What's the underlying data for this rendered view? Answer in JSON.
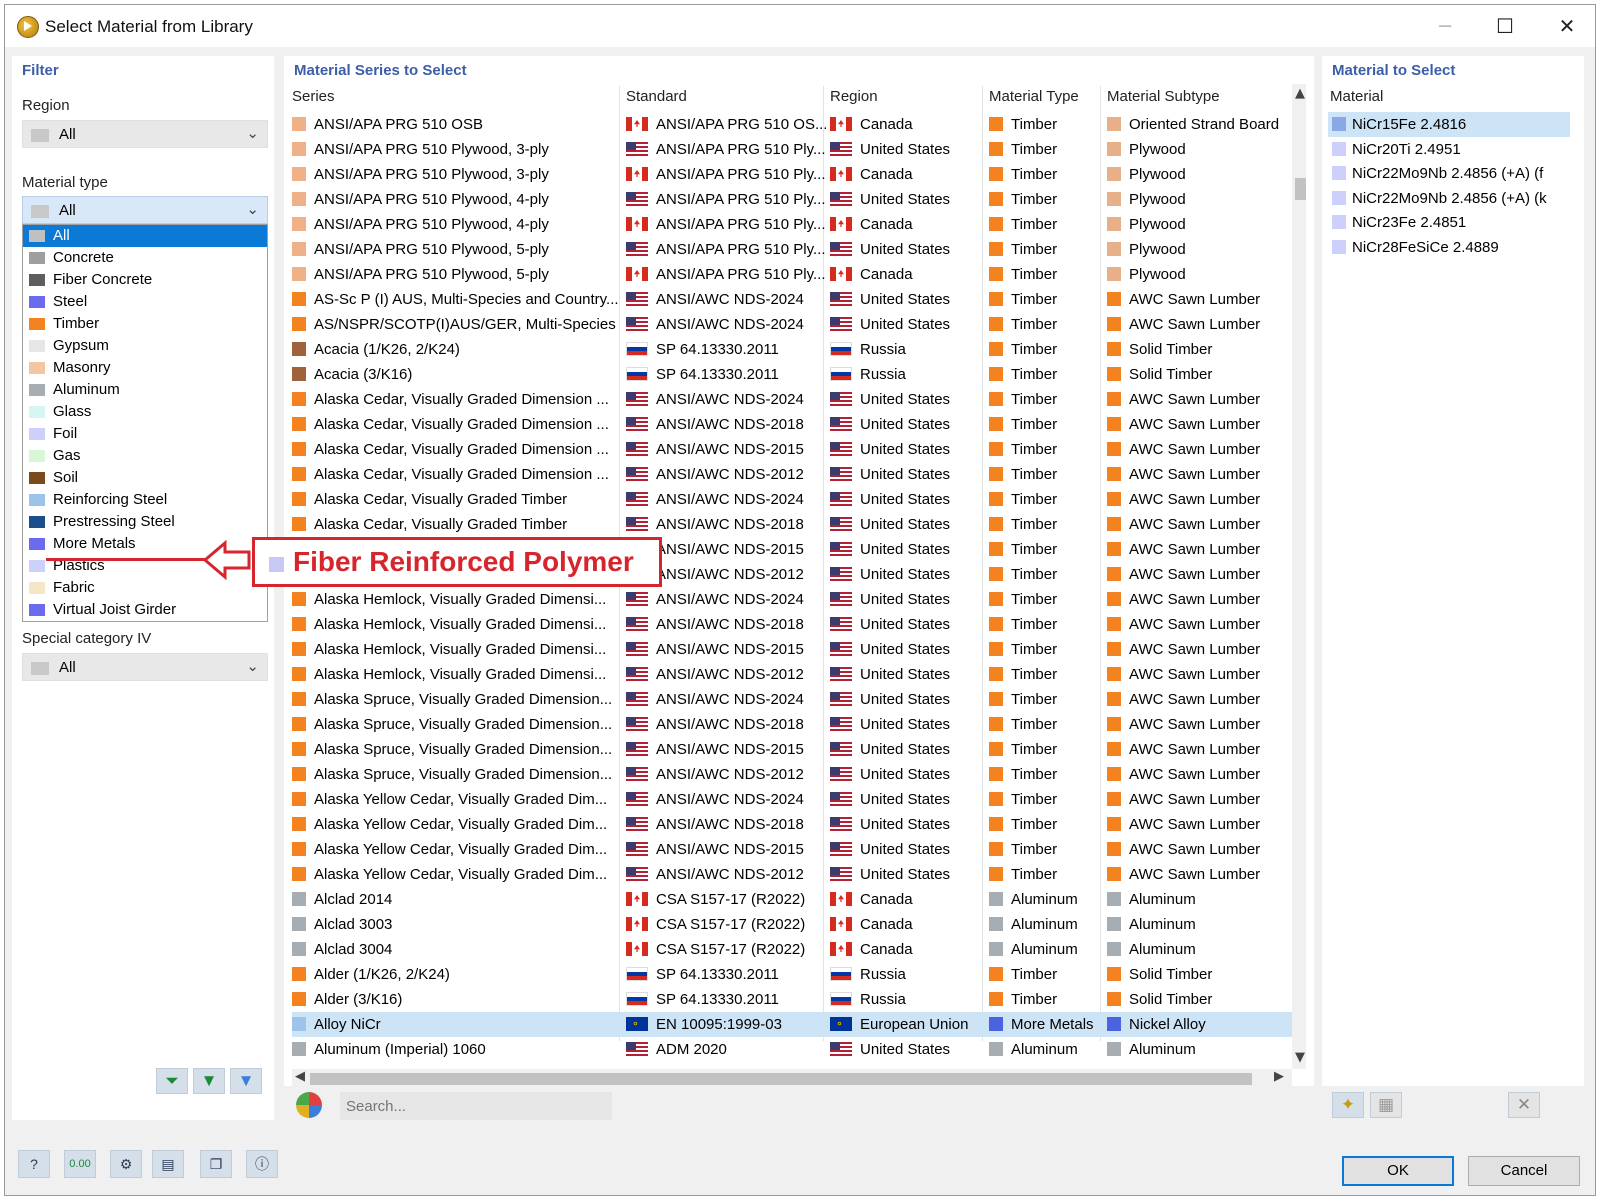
{
  "window": {
    "title": "Select Material from Library",
    "controls": {
      "minimize": "─",
      "maximize": "☐",
      "close": "✕"
    }
  },
  "filter": {
    "title": "Filter",
    "region_label": "Region",
    "region_value": "All",
    "material_type_label": "Material type",
    "material_type_value": "All",
    "material_types": [
      {
        "label": "All",
        "color": "#c0c0c0",
        "selected": true
      },
      {
        "label": "Concrete",
        "color": "#9e9e9e"
      },
      {
        "label": "Fiber Concrete",
        "color": "#5e5e5e"
      },
      {
        "label": "Steel",
        "color": "#6b6bf0"
      },
      {
        "label": "Timber",
        "color": "#f58220"
      },
      {
        "label": "Gypsum",
        "color": "#e6e6e6"
      },
      {
        "label": "Masonry",
        "color": "#f5c4a0"
      },
      {
        "label": "Aluminum",
        "color": "#a6aeb3"
      },
      {
        "label": "Glass",
        "color": "#d6f5f5"
      },
      {
        "label": "Foil",
        "color": "#cdd0fa"
      },
      {
        "label": "Gas",
        "color": "#d6f8d6"
      },
      {
        "label": "Soil",
        "color": "#7a4a1a"
      },
      {
        "label": "Reinforcing Steel",
        "color": "#9ec3ea"
      },
      {
        "label": "Prestressing Steel",
        "color": "#1a4f8c"
      },
      {
        "label": "More Metals",
        "color": "#6b6bf0"
      },
      {
        "label": "Plastics",
        "color": "#cdd0fa"
      },
      {
        "label": "Fabric",
        "color": "#f5e6c8"
      },
      {
        "label": "Virtual Joist Girder",
        "color": "#6b6bf0"
      }
    ],
    "special_category_label": "Special category IV",
    "special_category_value": "All"
  },
  "series_panel": {
    "title": "Material Series to Select",
    "columns": [
      "Series",
      "Standard",
      "Region",
      "Material Type",
      "Material Subtype"
    ],
    "rows": [
      {
        "series": "ANSI/APA PRG 510 OSB",
        "sc": "#f0b088",
        "standard": "ANSI/APA PRG 510 OS...",
        "flag": "ca",
        "region": "Canada",
        "type": "Timber",
        "tc": "#f58220",
        "subtype": "Oriented Strand Board",
        "stc": "#e8b088"
      },
      {
        "series": "ANSI/APA PRG 510 Plywood, 3-ply",
        "sc": "#f0b088",
        "standard": "ANSI/APA PRG 510 Ply...",
        "flag": "us",
        "region": "United States",
        "type": "Timber",
        "tc": "#f58220",
        "subtype": "Plywood",
        "stc": "#e8b088"
      },
      {
        "series": "ANSI/APA PRG 510 Plywood, 3-ply",
        "sc": "#f0b088",
        "standard": "ANSI/APA PRG 510 Ply...",
        "flag": "ca",
        "region": "Canada",
        "type": "Timber",
        "tc": "#f58220",
        "subtype": "Plywood",
        "stc": "#e8b088"
      },
      {
        "series": "ANSI/APA PRG 510 Plywood, 4-ply",
        "sc": "#f0b088",
        "standard": "ANSI/APA PRG 510 Ply...",
        "flag": "us",
        "region": "United States",
        "type": "Timber",
        "tc": "#f58220",
        "subtype": "Plywood",
        "stc": "#e8b088"
      },
      {
        "series": "ANSI/APA PRG 510 Plywood, 4-ply",
        "sc": "#f0b088",
        "standard": "ANSI/APA PRG 510 Ply...",
        "flag": "ca",
        "region": "Canada",
        "type": "Timber",
        "tc": "#f58220",
        "subtype": "Plywood",
        "stc": "#e8b088"
      },
      {
        "series": "ANSI/APA PRG 510 Plywood, 5-ply",
        "sc": "#f0b088",
        "standard": "ANSI/APA PRG 510 Ply...",
        "flag": "us",
        "region": "United States",
        "type": "Timber",
        "tc": "#f58220",
        "subtype": "Plywood",
        "stc": "#e8b088"
      },
      {
        "series": "ANSI/APA PRG 510 Plywood, 5-ply",
        "sc": "#f0b088",
        "standard": "ANSI/APA PRG 510 Ply...",
        "flag": "ca",
        "region": "Canada",
        "type": "Timber",
        "tc": "#f58220",
        "subtype": "Plywood",
        "stc": "#e8b088"
      },
      {
        "series": "AS-Sc P (I) AUS, Multi-Species and Country...",
        "sc": "#f58220",
        "standard": "ANSI/AWC NDS-2024",
        "flag": "us",
        "region": "United States",
        "type": "Timber",
        "tc": "#f58220",
        "subtype": "AWC Sawn Lumber",
        "stc": "#f58220"
      },
      {
        "series": "AS/NSPR/SCOTP(I)AUS/GER, Multi-Species ...",
        "sc": "#f58220",
        "standard": "ANSI/AWC NDS-2024",
        "flag": "us",
        "region": "United States",
        "type": "Timber",
        "tc": "#f58220",
        "subtype": "AWC Sawn Lumber",
        "stc": "#f58220"
      },
      {
        "series": "Acacia (1/K26, 2/K24)",
        "sc": "#a0623a",
        "standard": "SP 64.13330.2011",
        "flag": "ru",
        "region": "Russia",
        "type": "Timber",
        "tc": "#f58220",
        "subtype": "Solid Timber",
        "stc": "#f58220"
      },
      {
        "series": "Acacia (3/K16)",
        "sc": "#a0623a",
        "standard": "SP 64.13330.2011",
        "flag": "ru",
        "region": "Russia",
        "type": "Timber",
        "tc": "#f58220",
        "subtype": "Solid Timber",
        "stc": "#f58220"
      },
      {
        "series": "Alaska Cedar, Visually Graded Dimension ...",
        "sc": "#f58220",
        "standard": "ANSI/AWC NDS-2024",
        "flag": "us",
        "region": "United States",
        "type": "Timber",
        "tc": "#f58220",
        "subtype": "AWC Sawn Lumber",
        "stc": "#f58220"
      },
      {
        "series": "Alaska Cedar, Visually Graded Dimension ...",
        "sc": "#f58220",
        "standard": "ANSI/AWC NDS-2018",
        "flag": "us",
        "region": "United States",
        "type": "Timber",
        "tc": "#f58220",
        "subtype": "AWC Sawn Lumber",
        "stc": "#f58220"
      },
      {
        "series": "Alaska Cedar, Visually Graded Dimension ...",
        "sc": "#f58220",
        "standard": "ANSI/AWC NDS-2015",
        "flag": "us",
        "region": "United States",
        "type": "Timber",
        "tc": "#f58220",
        "subtype": "AWC Sawn Lumber",
        "stc": "#f58220"
      },
      {
        "series": "Alaska Cedar, Visually Graded Dimension ...",
        "sc": "#f58220",
        "standard": "ANSI/AWC NDS-2012",
        "flag": "us",
        "region": "United States",
        "type": "Timber",
        "tc": "#f58220",
        "subtype": "AWC Sawn Lumber",
        "stc": "#f58220"
      },
      {
        "series": "Alaska Cedar, Visually Graded Timber",
        "sc": "#f58220",
        "standard": "ANSI/AWC NDS-2024",
        "flag": "us",
        "region": "United States",
        "type": "Timber",
        "tc": "#f58220",
        "subtype": "AWC Sawn Lumber",
        "stc": "#f58220"
      },
      {
        "series": "Alaska Cedar, Visually Graded Timber",
        "sc": "#f58220",
        "standard": "ANSI/AWC NDS-2018",
        "flag": "us",
        "region": "United States",
        "type": "Timber",
        "tc": "#f58220",
        "subtype": "AWC Sawn Lumber",
        "stc": "#f58220"
      },
      {
        "series": "",
        "sc": "#f58220",
        "standard": "ANSI/AWC NDS-2015",
        "flag": "us",
        "region": "United States",
        "type": "Timber",
        "tc": "#f58220",
        "subtype": "AWC Sawn Lumber",
        "stc": "#f58220"
      },
      {
        "series": "",
        "sc": "#f58220",
        "standard": "ANSI/AWC NDS-2012",
        "flag": "us",
        "region": "United States",
        "type": "Timber",
        "tc": "#f58220",
        "subtype": "AWC Sawn Lumber",
        "stc": "#f58220"
      },
      {
        "series": "Alaska Hemlock, Visually Graded Dimensi...",
        "sc": "#f58220",
        "standard": "ANSI/AWC NDS-2024",
        "flag": "us",
        "region": "United States",
        "type": "Timber",
        "tc": "#f58220",
        "subtype": "AWC Sawn Lumber",
        "stc": "#f58220"
      },
      {
        "series": "Alaska Hemlock, Visually Graded Dimensi...",
        "sc": "#f58220",
        "standard": "ANSI/AWC NDS-2018",
        "flag": "us",
        "region": "United States",
        "type": "Timber",
        "tc": "#f58220",
        "subtype": "AWC Sawn Lumber",
        "stc": "#f58220"
      },
      {
        "series": "Alaska Hemlock, Visually Graded Dimensi...",
        "sc": "#f58220",
        "standard": "ANSI/AWC NDS-2015",
        "flag": "us",
        "region": "United States",
        "type": "Timber",
        "tc": "#f58220",
        "subtype": "AWC Sawn Lumber",
        "stc": "#f58220"
      },
      {
        "series": "Alaska Hemlock, Visually Graded Dimensi...",
        "sc": "#f58220",
        "standard": "ANSI/AWC NDS-2012",
        "flag": "us",
        "region": "United States",
        "type": "Timber",
        "tc": "#f58220",
        "subtype": "AWC Sawn Lumber",
        "stc": "#f58220"
      },
      {
        "series": "Alaska Spruce, Visually Graded Dimension...",
        "sc": "#f58220",
        "standard": "ANSI/AWC NDS-2024",
        "flag": "us",
        "region": "United States",
        "type": "Timber",
        "tc": "#f58220",
        "subtype": "AWC Sawn Lumber",
        "stc": "#f58220"
      },
      {
        "series": "Alaska Spruce, Visually Graded Dimension...",
        "sc": "#f58220",
        "standard": "ANSI/AWC NDS-2018",
        "flag": "us",
        "region": "United States",
        "type": "Timber",
        "tc": "#f58220",
        "subtype": "AWC Sawn Lumber",
        "stc": "#f58220"
      },
      {
        "series": "Alaska Spruce, Visually Graded Dimension...",
        "sc": "#f58220",
        "standard": "ANSI/AWC NDS-2015",
        "flag": "us",
        "region": "United States",
        "type": "Timber",
        "tc": "#f58220",
        "subtype": "AWC Sawn Lumber",
        "stc": "#f58220"
      },
      {
        "series": "Alaska Spruce, Visually Graded Dimension...",
        "sc": "#f58220",
        "standard": "ANSI/AWC NDS-2012",
        "flag": "us",
        "region": "United States",
        "type": "Timber",
        "tc": "#f58220",
        "subtype": "AWC Sawn Lumber",
        "stc": "#f58220"
      },
      {
        "series": "Alaska Yellow Cedar, Visually Graded Dim...",
        "sc": "#f58220",
        "standard": "ANSI/AWC NDS-2024",
        "flag": "us",
        "region": "United States",
        "type": "Timber",
        "tc": "#f58220",
        "subtype": "AWC Sawn Lumber",
        "stc": "#f58220"
      },
      {
        "series": "Alaska Yellow Cedar, Visually Graded Dim...",
        "sc": "#f58220",
        "standard": "ANSI/AWC NDS-2018",
        "flag": "us",
        "region": "United States",
        "type": "Timber",
        "tc": "#f58220",
        "subtype": "AWC Sawn Lumber",
        "stc": "#f58220"
      },
      {
        "series": "Alaska Yellow Cedar, Visually Graded Dim...",
        "sc": "#f58220",
        "standard": "ANSI/AWC NDS-2015",
        "flag": "us",
        "region": "United States",
        "type": "Timber",
        "tc": "#f58220",
        "subtype": "AWC Sawn Lumber",
        "stc": "#f58220"
      },
      {
        "series": "Alaska Yellow Cedar, Visually Graded Dim...",
        "sc": "#f58220",
        "standard": "ANSI/AWC NDS-2012",
        "flag": "us",
        "region": "United States",
        "type": "Timber",
        "tc": "#f58220",
        "subtype": "AWC Sawn Lumber",
        "stc": "#f58220"
      },
      {
        "series": "Alclad 2014",
        "sc": "#a6aeb3",
        "standard": "CSA S157-17 (R2022)",
        "flag": "ca",
        "region": "Canada",
        "type": "Aluminum",
        "tc": "#a6aeb3",
        "subtype": "Aluminum",
        "stc": "#a6aeb3"
      },
      {
        "series": "Alclad 3003",
        "sc": "#a6aeb3",
        "standard": "CSA S157-17 (R2022)",
        "flag": "ca",
        "region": "Canada",
        "type": "Aluminum",
        "tc": "#a6aeb3",
        "subtype": "Aluminum",
        "stc": "#a6aeb3"
      },
      {
        "series": "Alclad 3004",
        "sc": "#a6aeb3",
        "standard": "CSA S157-17 (R2022)",
        "flag": "ca",
        "region": "Canada",
        "type": "Aluminum",
        "tc": "#a6aeb3",
        "subtype": "Aluminum",
        "stc": "#a6aeb3"
      },
      {
        "series": "Alder (1/K26, 2/K24)",
        "sc": "#f58220",
        "standard": "SP 64.13330.2011",
        "flag": "ru",
        "region": "Russia",
        "type": "Timber",
        "tc": "#f58220",
        "subtype": "Solid Timber",
        "stc": "#f58220"
      },
      {
        "series": "Alder (3/K16)",
        "sc": "#f58220",
        "standard": "SP 64.13330.2011",
        "flag": "ru",
        "region": "Russia",
        "type": "Timber",
        "tc": "#f58220",
        "subtype": "Solid Timber",
        "stc": "#f58220"
      },
      {
        "series": "Alloy NiCr",
        "sc": "#9ec3ea",
        "standard": "EN 10095:1999-03",
        "flag": "eu",
        "region": "European Union",
        "type": "More Metals",
        "tc": "#4b63e0",
        "subtype": "Nickel Alloy",
        "stc": "#4b63e0",
        "selected": true
      },
      {
        "series": "Aluminum (Imperial) 1060",
        "sc": "#a6aeb3",
        "standard": "ADM 2020",
        "flag": "us",
        "region": "United States",
        "type": "Aluminum",
        "tc": "#a6aeb3",
        "subtype": "Aluminum",
        "stc": "#a6aeb3"
      }
    ]
  },
  "search": {
    "placeholder": "Search..."
  },
  "material_panel": {
    "title": "Material to Select",
    "column": "Material",
    "items": [
      {
        "label": "NiCr15Fe 2.4816",
        "color": "#8aa8e8",
        "selected": true
      },
      {
        "label": "NiCr20Ti 2.4951",
        "color": "#cdd0fa"
      },
      {
        "label": "NiCr22Mo9Nb 2.4856 (+A) (f",
        "color": "#cdd0fa"
      },
      {
        "label": "NiCr22Mo9Nb 2.4856 (+A) (k",
        "color": "#cdd0fa"
      },
      {
        "label": "NiCr23Fe 2.4851",
        "color": "#cdd0fa"
      },
      {
        "label": "NiCr28FeSiCe 2.4889",
        "color": "#cdd0fa"
      }
    ]
  },
  "buttons": {
    "ok": "OK",
    "cancel": "Cancel"
  },
  "bottom_tools": {
    "units_label": "0.00"
  },
  "annotation": {
    "text": "Fiber Reinforced Polymer",
    "color": "#d7252e"
  }
}
